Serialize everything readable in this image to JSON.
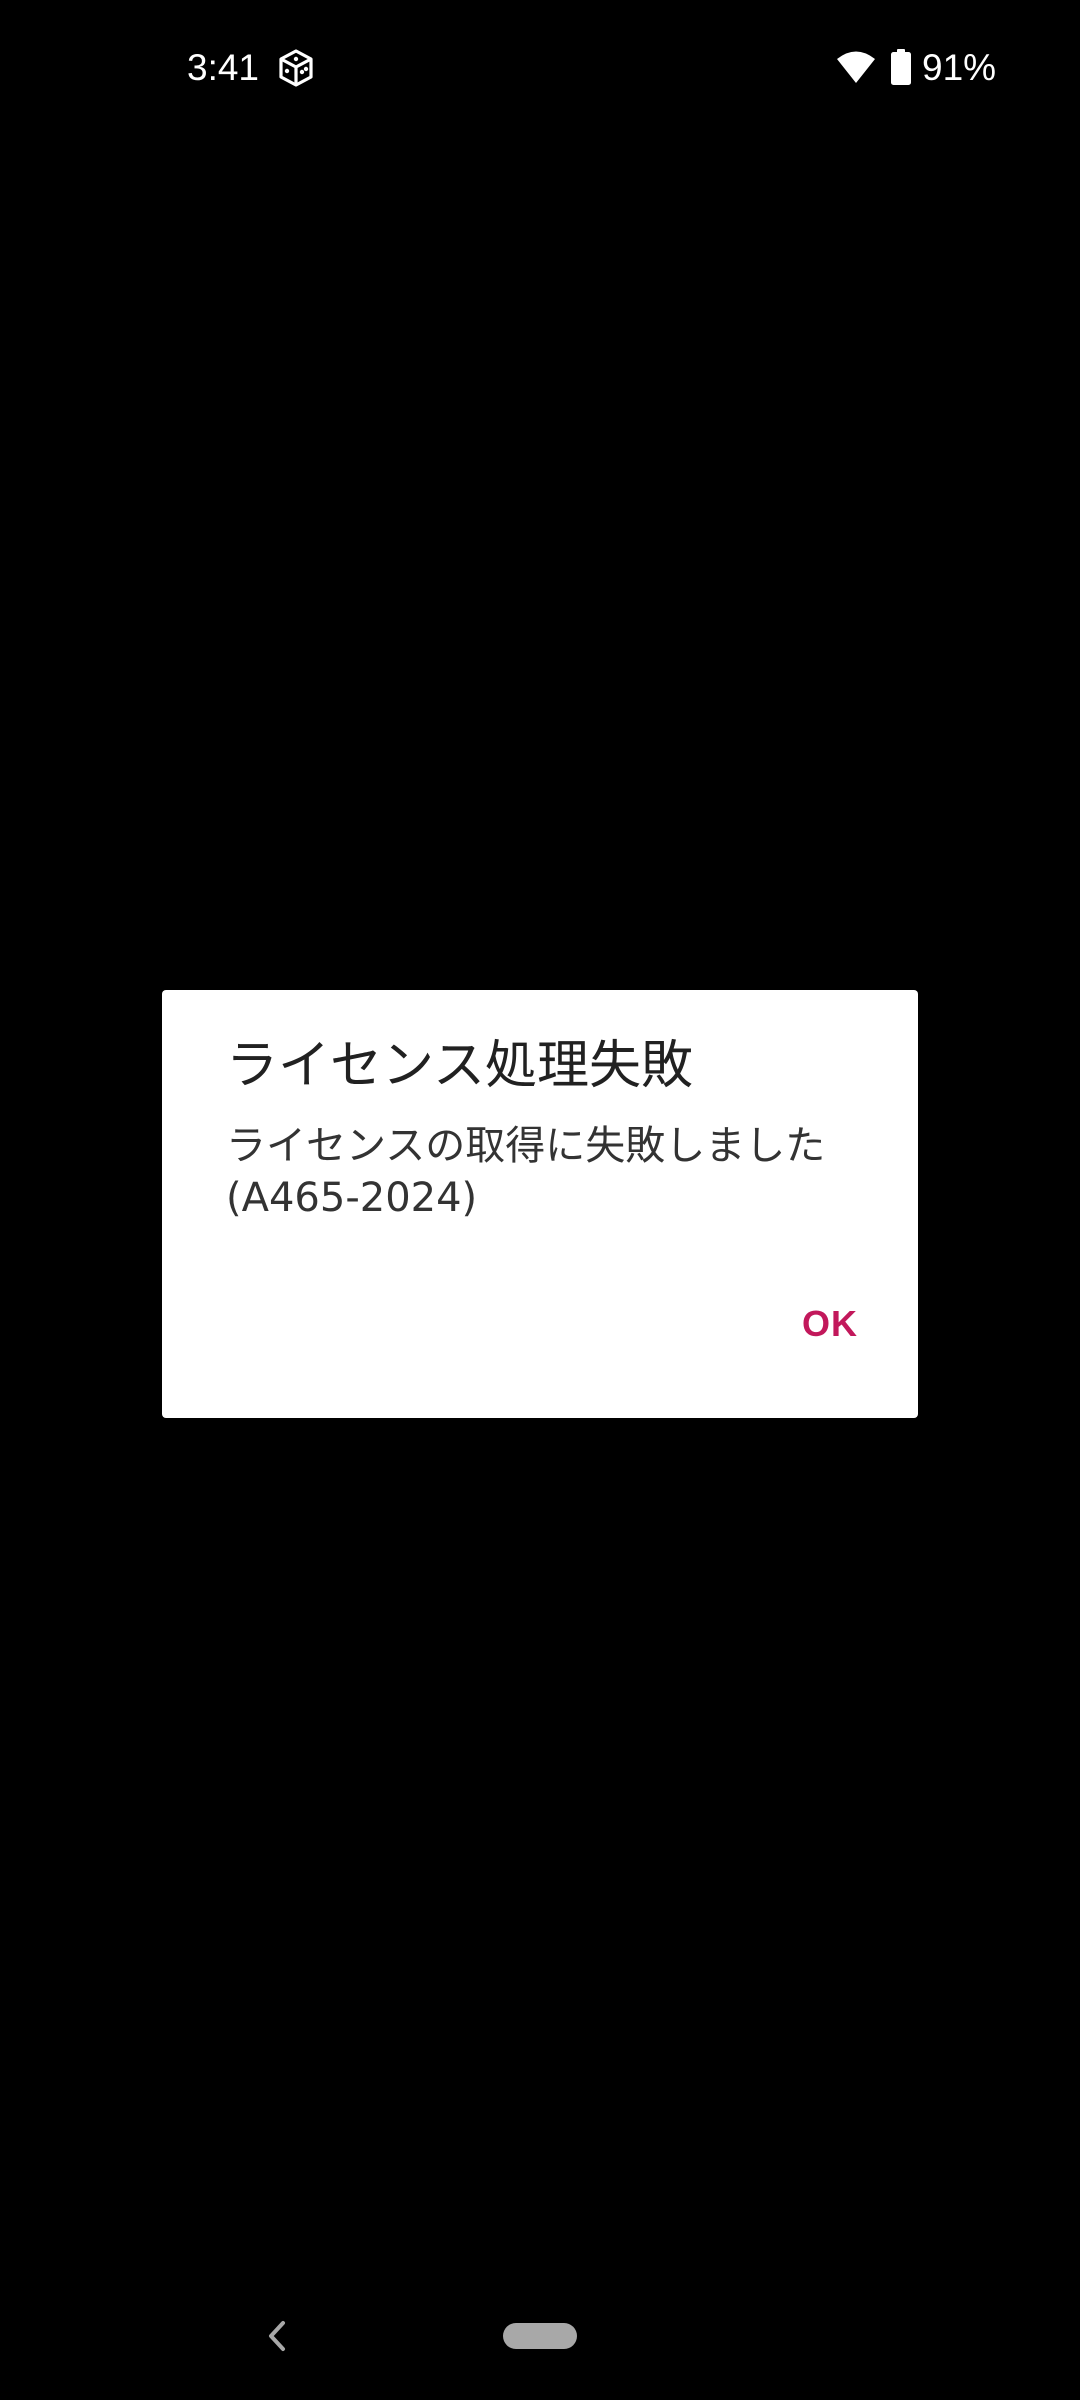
{
  "status_bar": {
    "time": "3:41",
    "battery_percent": "91%",
    "icons": [
      "app-notification-icon",
      "wifi-icon",
      "battery-icon"
    ]
  },
  "dialog": {
    "title": "ライセンス処理失敗",
    "message": "ライセンスの取得に失敗しました\n(A465-2024)",
    "ok_label": "OK"
  },
  "nav_bar": {
    "icons": [
      "back-icon",
      "home-pill"
    ]
  },
  "colors": {
    "background": "#000000",
    "dialog_background": "#ffffff",
    "accent": "#c2185b",
    "text_primary": "#212121"
  }
}
